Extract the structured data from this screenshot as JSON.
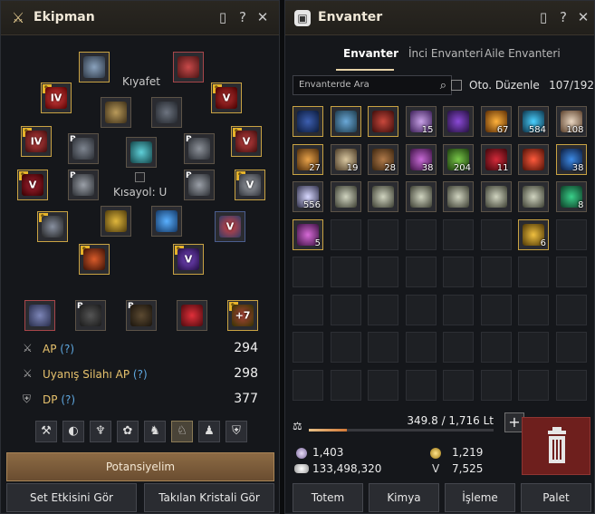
{
  "equipment": {
    "title": "Ekipman",
    "help_label": "?",
    "costume_label": "Kıyafet",
    "shortcut_label": "Kısayol: U",
    "stats": [
      {
        "label": "AP",
        "help": "(?)",
        "value": "294"
      },
      {
        "label": "Uyanış Silahı AP",
        "help": "(?)",
        "value": "298"
      },
      {
        "label": "DP",
        "help": "(?)",
        "value": "377"
      }
    ],
    "slot_marks": {
      "s1": "",
      "s2": "",
      "s3": "IV",
      "s4": "V",
      "s5": "IV",
      "s6": "V",
      "s7": "V",
      "s8": "V",
      "s9": "V",
      "s10": "",
      "s11": "V",
      "acc_enh": "+7"
    },
    "potential_button": "Potansiyelim",
    "set_effect_button": "Set Etkisini Gör",
    "crystal_button": "Takılan Kristali Gör",
    "colors": {
      "accent": "#e7c26d",
      "help": "#5fa8e0",
      "gold_border": "#c9a343"
    }
  },
  "inventory": {
    "title": "Envanter",
    "help_label": "?",
    "tabs": [
      "Envanter",
      "İnci Envanteri",
      "Aile Envanteri"
    ],
    "search_placeholder": "Envanterde Ara",
    "auto_sort_label": "Oto. Düzenle",
    "capacity": "107/192",
    "weight": "349.8 / 1,716 Lt",
    "weight_fraction": 0.204,
    "currency": {
      "pearls": "1,403",
      "silver": "133,498,320",
      "energy_coin": "1,219",
      "contribution": "7,525"
    },
    "contribution_label": "V",
    "buttons": [
      "Totem",
      "Kimya",
      "İşleme",
      "Palet"
    ],
    "item_qty": {
      "r1c4": "15",
      "r1c6": "67",
      "r1c7": "584",
      "r1c8": "108",
      "r2c1": "27",
      "r2c2": "19",
      "r2c3": "28",
      "r2c4": "38",
      "r2c5": "204",
      "r2c6": "11",
      "r2c8": "38",
      "r3c1": "556",
      "r3c8": "8",
      "r4c1": "5",
      "r4c7": "6"
    }
  }
}
